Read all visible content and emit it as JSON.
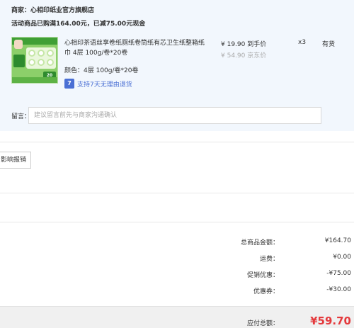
{
  "store": {
    "merchant": "商家：心相印纸业官方旗舰店",
    "promo": "活动商品已购满164.00元，已减75.00元现金"
  },
  "product": {
    "image_alt": "心相印茶语丝享卷纸",
    "title": "心相印茶语丝享卷纸厕纸卷筒纸有芯卫生纸整箱纸巾 4层 100g/卷*20卷",
    "spec": "颜色：4层 100g/卷*20卷",
    "service_icon": "7",
    "service_text": "支持7天无理由退货",
    "price_main": "¥ 19.90 到手价",
    "price_ref": "¥ 54.90 京东价",
    "qty": "x3",
    "stock": "有货"
  },
  "remark": {
    "label": "留言：",
    "placeholder": "建议留言前先与商家沟通确认"
  },
  "invoice": {
    "button_label": "影响报销"
  },
  "summary": [
    {
      "label": "总商品金额：",
      "value": "¥164.70"
    },
    {
      "label": "运费：",
      "value": "¥0.00"
    },
    {
      "label": "促销优惠：",
      "value": "-¥75.00"
    },
    {
      "label": "优惠券：",
      "value": "-¥30.00"
    }
  ],
  "payable": {
    "label": "应付总额：",
    "amount": "¥59.70"
  },
  "colors": {
    "panel_bg": "#f2f7fd",
    "accent_red": "#e4393c",
    "service_blue": "#4a6fd4"
  }
}
